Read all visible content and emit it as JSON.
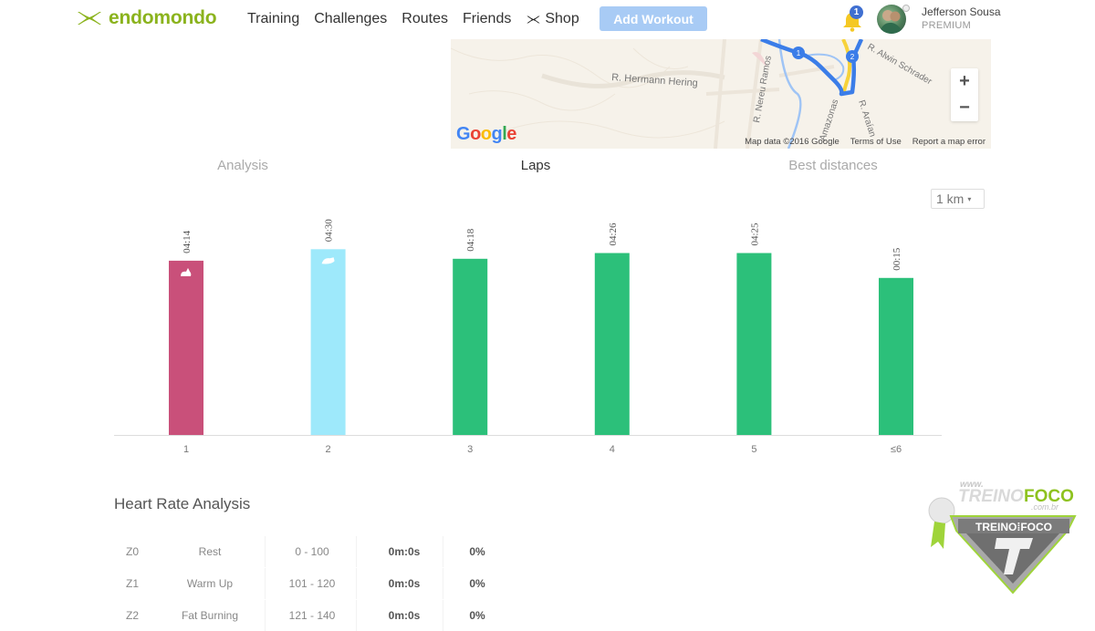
{
  "header": {
    "brand": "endomondo",
    "nav": [
      {
        "label": "Training"
      },
      {
        "label": "Challenges"
      },
      {
        "label": "Routes"
      },
      {
        "label": "Friends"
      },
      {
        "label": "Shop",
        "icon": "under-armour-icon"
      }
    ],
    "add_workout_label": "Add Workout",
    "notification_count": "1",
    "user_name": "Jefferson Sousa",
    "user_tier": "PREMIUM"
  },
  "map": {
    "street_labels": [
      "R. Hermann Hering",
      "R. Nereu Ramos",
      "R. Alwin Schrader",
      "R. Araían",
      "Amazonas"
    ],
    "markers": [
      "1",
      "2"
    ],
    "google_label": "Google",
    "attribution": "Map data ©2016 Google",
    "terms_label": "Terms of Use",
    "report_label": "Report a map error",
    "zoom_in_label": "+",
    "zoom_out_label": "−",
    "colors": {
      "route": "#3b7de8",
      "highlight": "#f7d23a",
      "background": "#f6f2ea"
    }
  },
  "tabs": [
    {
      "label": "Analysis",
      "active": false
    },
    {
      "label": "Laps",
      "active": true
    },
    {
      "label": "Best distances",
      "active": false
    }
  ],
  "lap_unit_select": {
    "value": "1 km",
    "caret": "▾"
  },
  "chart_data": {
    "type": "bar",
    "title": "Laps",
    "xlabel": "",
    "ylabel": "",
    "categories": [
      "1",
      "2",
      "3",
      "4",
      "5",
      "≤6"
    ],
    "labels": [
      "04:14",
      "04:30",
      "04:18",
      "04:26",
      "04:25",
      "00:15"
    ],
    "values": [
      0.91,
      0.97,
      0.92,
      0.95,
      0.95,
      0.82
    ],
    "value_meaning": "relative bar height (fraction of chart max)",
    "colors": [
      "#c9507a",
      "#9ee9fb",
      "#2cc07a",
      "#2cc07a",
      "#2cc07a",
      "#2cc07a"
    ],
    "markers": [
      {
        "index": 0,
        "icon": "rabbit-icon",
        "meaning": "fastest"
      },
      {
        "index": 1,
        "icon": "turtle-icon",
        "meaning": "slowest"
      }
    ],
    "grid": false
  },
  "heart_rate": {
    "title": "Heart Rate Analysis",
    "rows": [
      {
        "zone": "Z0",
        "name": "Rest",
        "range": "0 - 100",
        "time": "0m:0s",
        "percent": "0%"
      },
      {
        "zone": "Z1",
        "name": "Warm Up",
        "range": "101 - 120",
        "time": "0m:0s",
        "percent": "0%"
      },
      {
        "zone": "Z2",
        "name": "Fat Burning",
        "range": "121 - 140",
        "time": "0m:0s",
        "percent": "0%"
      }
    ]
  },
  "watermark": {
    "url_text": "www.",
    "brand_left": "TREINO",
    "brand_right": "FOCO",
    "domain": ".com.br"
  }
}
